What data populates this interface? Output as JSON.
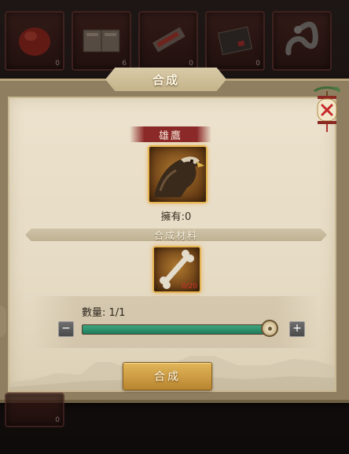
{
  "background_slots": [
    {
      "name": "slot-helmet",
      "count": "0",
      "icon": "helmet-icon"
    },
    {
      "name": "slot-book",
      "count": "6",
      "icon": "book-icon"
    },
    {
      "name": "slot-scroll",
      "count": "0",
      "icon": "scroll-icon"
    },
    {
      "name": "slot-manual",
      "count": "0",
      "icon": "manual-icon"
    },
    {
      "name": "slot-serpent",
      "count": "",
      "icon": "serpent-icon"
    }
  ],
  "bottom_slot": {
    "count": "0"
  },
  "dialog": {
    "title": "合成",
    "close_icon": "lantern-close-icon"
  },
  "target": {
    "name": "雄鷹",
    "icon": "eagle-icon",
    "owned_text": "擁有:0"
  },
  "materials_header": "合成材料",
  "material": {
    "icon": "bone-icon",
    "count_text": "0/20"
  },
  "quantity": {
    "label_text": "數量: 1/1",
    "value": 1,
    "max": 1,
    "minus_label": "−",
    "plus_label": "+"
  },
  "craft_button_label": "合成",
  "colors": {
    "gold_border": "#e6b450",
    "slider_fill": "#2f9a72",
    "banner_red": "#8b2828",
    "button_gold": "#d1a24a"
  }
}
